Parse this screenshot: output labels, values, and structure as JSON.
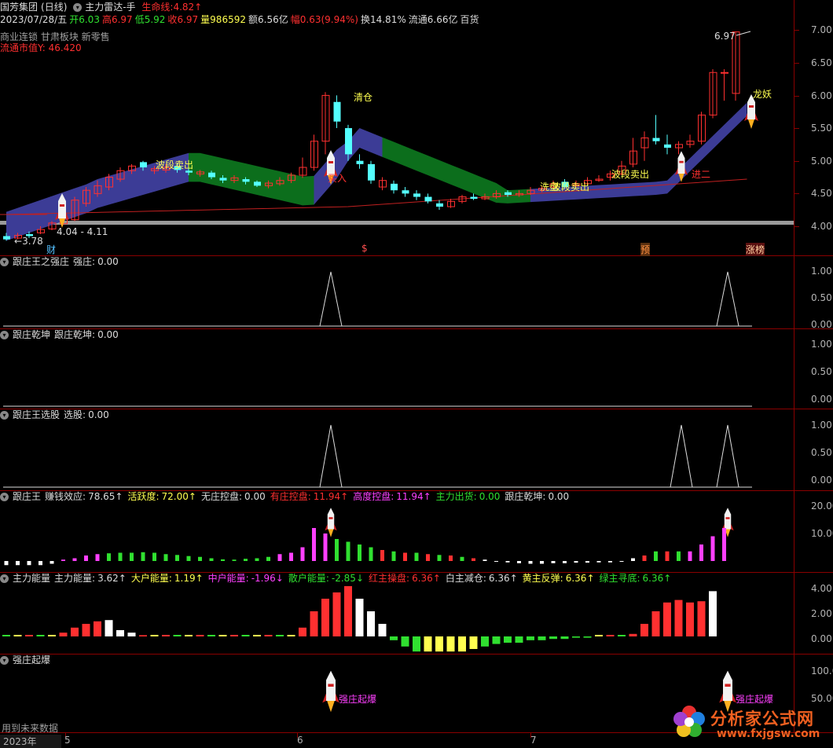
{
  "header": {
    "stock_name": "国芳集团",
    "period": "(日线)",
    "indicator": "主力雷达-手",
    "lifeline_label": "生命线:",
    "lifeline_value": "4.82",
    "date": "2023/07/28/五",
    "open_label": "开",
    "open": "6.03",
    "high_label": "高",
    "high": "6.97",
    "low_label": "低",
    "low": "5.92",
    "close_label": "收",
    "close": "6.97",
    "volume_label": "量",
    "volume": "986592",
    "amount_label": "额",
    "amount": "6.56亿",
    "change_label": "幅",
    "change": "0.63(9.94%)",
    "turnover_label": "换",
    "turnover": "14.81%",
    "float_label": "流通",
    "float_cap": "6.66亿",
    "industry": "百货",
    "tags": "商业连锁 甘肃板块 新零售",
    "float_value_label": "流通市值Y",
    "float_value": ": 46.420"
  },
  "price_axis": [
    "7.00",
    "6.50",
    "6.00",
    "5.50",
    "5.00",
    "4.50",
    "4.00"
  ],
  "chart_text": {
    "max_label": "6.97",
    "min_label": "3.78",
    "range_label": "4.04 - 4.11",
    "qingcang": "清仓",
    "wave_sell_1": "波段卖出",
    "wave_sell_2": "波段卖出",
    "wave_sell_3": "波段卖出",
    "xipan": "洗盘",
    "longyao": "龙妖",
    "jianjin": "进二",
    "buy_in": "买入",
    "marker_cai": "财",
    "marker_dollar": "$",
    "marker_yu": "预",
    "marker_zhangbang": "涨榜"
  },
  "panels": [
    {
      "name": "跟庄王之强庄",
      "fields": [
        {
          "label": "强庄:",
          "value": "0.00",
          "color": "#dcdcdc"
        }
      ],
      "axis": [
        "1.00",
        "0.50",
        "0.00"
      ]
    },
    {
      "name": "跟庄乾坤",
      "fields": [
        {
          "label": "跟庄乾坤:",
          "value": "0.00",
          "color": "#dcdcdc"
        }
      ],
      "axis": [
        "1.00",
        "0.50",
        "0.00"
      ]
    },
    {
      "name": "跟庄王选股",
      "fields": [
        {
          "label": "选股:",
          "value": "0.00",
          "color": "#dcdcdc"
        }
      ],
      "axis": [
        "1.00",
        "0.50",
        "0.00"
      ]
    },
    {
      "name": "跟庄王",
      "fields": [
        {
          "label": "赚钱效应:",
          "value": "78.65",
          "arrow": "↑",
          "color": "#dcdcdc"
        },
        {
          "label": "活跃度:",
          "value": "72.00",
          "arrow": "↑",
          "color": "#ffff50"
        },
        {
          "label": "无庄控盘:",
          "value": "0.00",
          "color": "#dcdcdc"
        },
        {
          "label": "有庄控盘:",
          "value": "11.94",
          "arrow": "↑",
          "color": "#ff3030"
        },
        {
          "label": "高度控盘:",
          "value": "11.94",
          "arrow": "↑",
          "color": "#ff40ff"
        },
        {
          "label": "主力出货:",
          "value": "0.00",
          "color": "#30e030"
        },
        {
          "label": "跟庄乾坤:",
          "value": "0.00",
          "color": "#dcdcdc"
        }
      ],
      "axis": [
        "20.00",
        "10.00"
      ]
    },
    {
      "name": "主力能量",
      "fields": [
        {
          "label": "主力能量:",
          "value": "3.62",
          "arrow": "↑",
          "color": "#dcdcdc"
        },
        {
          "label": "大户能量:",
          "value": "1.19",
          "arrow": "↑",
          "color": "#ffff50"
        },
        {
          "label": "中户能量:",
          "value": "-1.96",
          "arrow": "↓",
          "color": "#ff40ff"
        },
        {
          "label": "散户能量:",
          "value": "-2.85",
          "arrow": "↓",
          "color": "#30e030"
        },
        {
          "label": "红主操盘:",
          "value": "6.36",
          "arrow": "↑",
          "color": "#ff3030"
        },
        {
          "label": "白主减仓:",
          "value": "6.36",
          "arrow": "↑",
          "color": "#dcdcdc"
        },
        {
          "label": "黄主反弹:",
          "value": "6.36",
          "arrow": "↑",
          "color": "#ffff50"
        },
        {
          "label": "绿主寻底:",
          "value": "6.36",
          "arrow": "↑",
          "color": "#30e030"
        }
      ],
      "axis": [
        "4.00",
        "2.00",
        "0.00"
      ]
    },
    {
      "name": "强庄起爆",
      "fields": [],
      "axis": [
        "100.0",
        "50.00"
      ],
      "signal": "强庄起爆"
    }
  ],
  "footer": {
    "future_data": "用到未来数据",
    "year": "2023年",
    "months": [
      "5",
      "6",
      "7"
    ]
  },
  "watermark": {
    "title": "分析家公式网",
    "url": "www.fxjgsw.com"
  },
  "colors": {
    "up": "#ff3030",
    "down": "#54ffff",
    "lifeline": "#ff3030",
    "band_blue": "#3c3c96",
    "band_green": "#0c6e1c",
    "accent": "#ffff50"
  }
}
